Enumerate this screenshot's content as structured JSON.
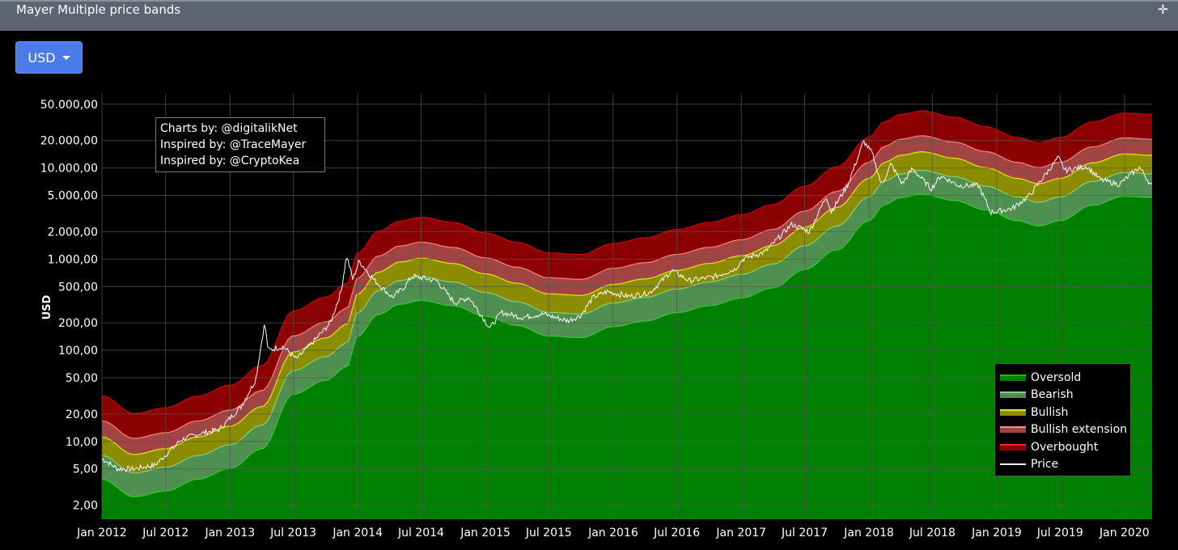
{
  "header": {
    "title": "Mayer Multiple price bands",
    "move_icon": "move-arrows-icon"
  },
  "currency": {
    "label": "USD",
    "icon": "caret-down-icon"
  },
  "credits": [
    "Charts by: @digitalikNet",
    "Inspired by: @TraceMayer",
    "Inspired by: @CryptoKea"
  ],
  "colors": {
    "oversold": "#008000",
    "bearish": "#4f8f4f",
    "bullish": "#8c8c00",
    "bullish_extension": "#a04444",
    "overbought": "#8b0000",
    "price": "#ffffff",
    "grid": "#555555"
  },
  "chart_data": {
    "type": "area",
    "title": "Mayer Multiple price bands",
    "ylabel": "USD",
    "yscale": "log",
    "ylim": [
      1.4,
      65000
    ],
    "xlim": [
      "2012-01-01",
      "2020-03-20"
    ],
    "grid": true,
    "legend_position": "bottom-right",
    "yticks": [
      {
        "value": 2,
        "label": "2,00"
      },
      {
        "value": 5,
        "label": "5,00"
      },
      {
        "value": 10,
        "label": "10,00"
      },
      {
        "value": 20,
        "label": "20,00"
      },
      {
        "value": 50,
        "label": "50,00"
      },
      {
        "value": 100,
        "label": "100,00"
      },
      {
        "value": 200,
        "label": "200,00"
      },
      {
        "value": 500,
        "label": "500,00"
      },
      {
        "value": 1000,
        "label": "1.000,00"
      },
      {
        "value": 2000,
        "label": "2.000,00"
      },
      {
        "value": 5000,
        "label": "5.000,00"
      },
      {
        "value": 10000,
        "label": "10.000,00"
      },
      {
        "value": 20000,
        "label": "20.000,00"
      },
      {
        "value": 50000,
        "label": "50.000,00"
      }
    ],
    "xticks": [
      {
        "date": "2012-01-01",
        "label": "Jan 2012"
      },
      {
        "date": "2012-07-01",
        "label": "Jul 2012"
      },
      {
        "date": "2013-01-01",
        "label": "Jan 2013"
      },
      {
        "date": "2013-07-01",
        "label": "Jul 2013"
      },
      {
        "date": "2014-01-01",
        "label": "Jan 2014"
      },
      {
        "date": "2014-07-01",
        "label": "Jul 2014"
      },
      {
        "date": "2015-01-01",
        "label": "Jan 2015"
      },
      {
        "date": "2015-07-01",
        "label": "Jul 2015"
      },
      {
        "date": "2016-01-01",
        "label": "Jan 2016"
      },
      {
        "date": "2016-07-01",
        "label": "Jul 2016"
      },
      {
        "date": "2017-01-01",
        "label": "Jan 2017"
      },
      {
        "date": "2017-07-01",
        "label": "Jul 2017"
      },
      {
        "date": "2018-01-01",
        "label": "Jan 2018"
      },
      {
        "date": "2018-07-01",
        "label": "Jul 2018"
      },
      {
        "date": "2019-01-01",
        "label": "Jan 2019"
      },
      {
        "date": "2019-07-01",
        "label": "Jul 2019"
      },
      {
        "date": "2020-01-01",
        "label": "Jan 2020"
      }
    ],
    "series": [
      {
        "name": "Oversold",
        "key": "oversold",
        "multiplier": 0.55
      },
      {
        "name": "Bearish",
        "key": "bearish",
        "multiplier": 1.0
      },
      {
        "name": "Bullish",
        "key": "bullish",
        "multiplier": 1.6
      },
      {
        "name": "Bullish extension",
        "key": "bullish_extension",
        "multiplier": 2.4
      },
      {
        "name": "Overbought",
        "key": "overbought",
        "multiplier": 4.5
      },
      {
        "name": "Price",
        "key": "price",
        "type": "line"
      }
    ],
    "base_sma200": {
      "dates": [
        "2012-01-01",
        "2012-04-01",
        "2012-07-01",
        "2012-10-01",
        "2013-01-01",
        "2013-04-01",
        "2013-07-01",
        "2013-10-01",
        "2013-12-01",
        "2014-01-01",
        "2014-03-01",
        "2014-05-01",
        "2014-07-01",
        "2014-10-01",
        "2015-01-01",
        "2015-04-01",
        "2015-07-01",
        "2015-10-01",
        "2016-01-01",
        "2016-04-01",
        "2016-07-01",
        "2016-10-01",
        "2017-01-01",
        "2017-04-01",
        "2017-07-01",
        "2017-10-01",
        "2018-01-01",
        "2018-02-15",
        "2018-04-01",
        "2018-06-01",
        "2018-09-01",
        "2018-12-01",
        "2019-03-01",
        "2019-05-01",
        "2019-07-01",
        "2019-10-01",
        "2020-01-01",
        "2020-03-20"
      ],
      "values": [
        7,
        4.5,
        5.2,
        7,
        9.2,
        15,
        60,
        85,
        120,
        260,
        450,
        580,
        640,
        560,
        430,
        340,
        260,
        250,
        330,
        380,
        470,
        560,
        680,
        880,
        1400,
        2300,
        4800,
        7200,
        8600,
        9400,
        8000,
        6300,
        4800,
        4200,
        4800,
        7100,
        8900,
        8600
      ]
    },
    "price": {
      "dates": [
        "2012-01-01",
        "2012-02-15",
        "2012-04-01",
        "2012-06-01",
        "2012-08-15",
        "2012-10-01",
        "2012-12-01",
        "2013-02-01",
        "2013-03-15",
        "2013-04-10",
        "2013-04-20",
        "2013-06-01",
        "2013-07-10",
        "2013-09-01",
        "2013-10-15",
        "2013-11-15",
        "2013-11-30",
        "2013-12-18",
        "2014-01-05",
        "2014-02-15",
        "2014-04-10",
        "2014-05-15",
        "2014-06-05",
        "2014-08-15",
        "2014-10-05",
        "2014-11-15",
        "2015-01-14",
        "2015-02-15",
        "2015-04-15",
        "2015-06-15",
        "2015-08-24",
        "2015-09-30",
        "2015-11-04",
        "2015-12-15",
        "2016-02-15",
        "2016-04-15",
        "2016-06-17",
        "2016-08-05",
        "2016-10-15",
        "2016-12-15",
        "2017-01-05",
        "2017-03-10",
        "2017-05-25",
        "2017-07-15",
        "2017-09-01",
        "2017-09-15",
        "2017-11-01",
        "2017-12-17",
        "2018-01-10",
        "2018-02-06",
        "2018-03-05",
        "2018-04-06",
        "2018-05-05",
        "2018-06-28",
        "2018-07-25",
        "2018-09-15",
        "2018-11-10",
        "2018-12-15",
        "2019-02-15",
        "2019-04-05",
        "2019-05-15",
        "2019-06-26",
        "2019-07-15",
        "2019-09-15",
        "2019-10-25",
        "2019-12-17",
        "2020-02-13",
        "2020-03-20"
      ],
      "values": [
        6.5,
        5,
        5,
        5.5,
        10.5,
        12,
        13.5,
        24,
        47,
        200,
        100,
        110,
        80,
        130,
        200,
        450,
        1100,
        600,
        950,
        600,
        380,
        500,
        650,
        580,
        330,
        380,
        175,
        260,
        230,
        250,
        210,
        240,
        380,
        440,
        390,
        430,
        750,
        580,
        640,
        780,
        1000,
        1200,
        2400,
        2000,
        4900,
        3300,
        6500,
        19500,
        14500,
        6500,
        11000,
        6700,
        9800,
        5900,
        8200,
        6400,
        6400,
        3250,
        3600,
        5000,
        8000,
        13000,
        9400,
        10400,
        7400,
        6600,
        10200,
        6200
      ]
    }
  }
}
